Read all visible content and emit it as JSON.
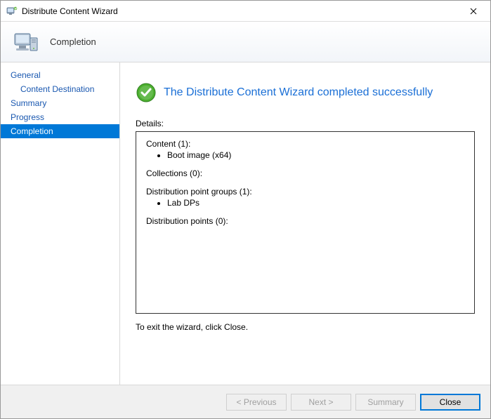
{
  "window": {
    "title": "Distribute Content Wizard"
  },
  "banner": {
    "heading": "Completion"
  },
  "sidebar": {
    "steps": [
      {
        "label": "General",
        "indent": false,
        "active": false
      },
      {
        "label": "Content Destination",
        "indent": true,
        "active": false
      },
      {
        "label": "Summary",
        "indent": false,
        "active": false
      },
      {
        "label": "Progress",
        "indent": false,
        "active": false
      },
      {
        "label": "Completion",
        "indent": false,
        "active": true
      }
    ]
  },
  "main": {
    "headline": "The Distribute Content Wizard completed successfully",
    "details_label": "Details:",
    "details": {
      "content": {
        "heading": "Content (1):",
        "items": [
          "Boot image (x64)"
        ]
      },
      "collections": {
        "heading": "Collections (0):",
        "items": []
      },
      "dp_groups": {
        "heading": "Distribution point groups (1):",
        "items": [
          "Lab DPs"
        ]
      },
      "dps": {
        "heading": "Distribution points (0):",
        "items": []
      }
    },
    "exit_hint": "To exit the wizard, click Close."
  },
  "footer": {
    "previous": "< Previous",
    "next": "Next >",
    "summary": "Summary",
    "close": "Close"
  },
  "colors": {
    "accent": "#0078d7",
    "link": "#1a6fd6"
  }
}
